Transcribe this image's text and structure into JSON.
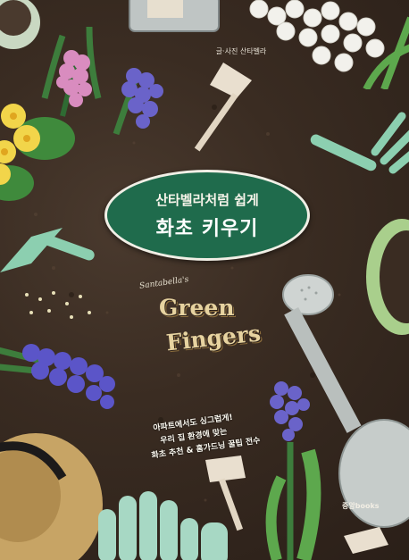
{
  "book": {
    "author": "글·사진 산타벨라",
    "title_line1": "산타벨라처럼 쉽게",
    "title_line2": "화초 키우기",
    "series_small": "Santabella's",
    "series_word1": "Green",
    "series_word2": "Fingers",
    "tagline": [
      "아파트에서도 싱그럽게!",
      "우리 집 환경에 맞는",
      "화초 추천 & 홈가드닝 꿀팁 전수"
    ],
    "publisher": "중앙books"
  },
  "colors": {
    "soil": "#3a2c22",
    "badge_green": "#1f6b4c",
    "tool_teal": "#8ccfb0",
    "gold_text": "#e7d3a0"
  }
}
